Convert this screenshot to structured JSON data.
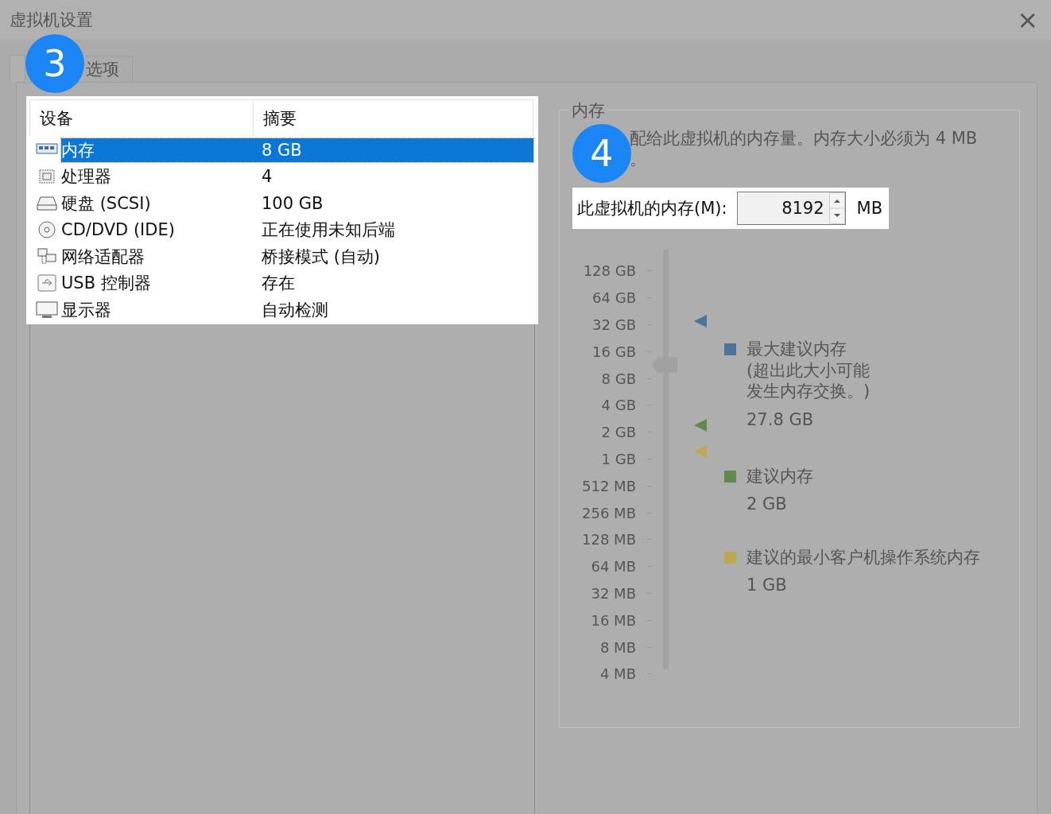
{
  "window": {
    "title": "虚拟机设置",
    "close": "×"
  },
  "tabs": [
    {
      "selected": true
    },
    {
      "label": "选项",
      "selected": false
    }
  ],
  "devices": {
    "columns": [
      "设备",
      "摘要"
    ],
    "rows": [
      {
        "kind": "memory",
        "name": "内存",
        "summary": "8 GB",
        "selected": true
      },
      {
        "kind": "cpu",
        "name": "处理器",
        "summary": "4",
        "selected": false
      },
      {
        "kind": "disk",
        "name": "硬盘 (SCSI)",
        "summary": "100 GB",
        "selected": false
      },
      {
        "kind": "cd",
        "name": "CD/DVD (IDE)",
        "summary": "正在使用未知后端",
        "selected": false
      },
      {
        "kind": "network",
        "name": "网络适配器",
        "summary": "桥接模式 (自动)",
        "selected": false
      },
      {
        "kind": "usb",
        "name": "USB 控制器",
        "summary": "存在",
        "selected": false
      },
      {
        "kind": "display",
        "name": "显示器",
        "summary": "自动检测",
        "selected": false
      }
    ]
  },
  "memory": {
    "group_title": "内存",
    "description_lines": [
      "配给此虚拟机的内存量。内存大小必须为 4 MB",
      "。"
    ],
    "field_label": "此虚拟机的内存(M):",
    "value": "8192",
    "unit": "MB",
    "slider": {
      "level": 0.733,
      "ticks": [
        "128 GB",
        "64 GB",
        "32 GB",
        "16 GB",
        "8 GB",
        "4 GB",
        "2 GB",
        "1 GB",
        "512 MB",
        "256 MB",
        "128 MB",
        "64 MB",
        "32 MB",
        "16 MB",
        "8 MB",
        "4 MB"
      ]
    },
    "legend": [
      {
        "color": "#4a7597",
        "title": "最大建议内存",
        "note_lines": [
          "(超出此大小可能",
          "发生内存交换。)"
        ],
        "value": "27.8 GB"
      },
      {
        "color": "#5f8a4a",
        "title": "建议内存",
        "value": "2 GB"
      },
      {
        "color": "#bda84e",
        "title": "建议的最小客户机操作系统内存",
        "value": "1 GB"
      }
    ]
  },
  "callouts": [
    {
      "number": "3"
    },
    {
      "number": "4"
    }
  ]
}
